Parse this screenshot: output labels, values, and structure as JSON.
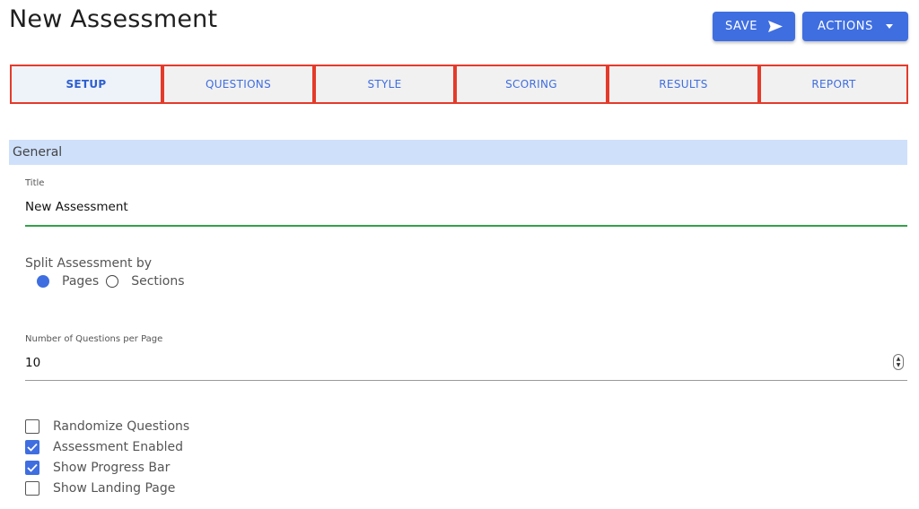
{
  "page_title": "New Assessment",
  "toolbar": {
    "save_label": "SAVE",
    "actions_label": "ACTIONS"
  },
  "tabs": [
    {
      "label": "SETUP",
      "active": true
    },
    {
      "label": "QUESTIONS",
      "active": false
    },
    {
      "label": "STYLE",
      "active": false
    },
    {
      "label": "SCORING",
      "active": false
    },
    {
      "label": "RESULTS",
      "active": false
    },
    {
      "label": "REPORT",
      "active": false
    }
  ],
  "section": {
    "title": "General"
  },
  "title_field": {
    "label": "Title",
    "value": "New Assessment"
  },
  "split": {
    "label": "Split Assessment by",
    "options": [
      {
        "label": "Pages",
        "selected": true
      },
      {
        "label": "Sections",
        "selected": false
      }
    ]
  },
  "questions_per_page": {
    "label": "Number of Questions per Page",
    "value": "10"
  },
  "checkboxes": [
    {
      "label": "Randomize Questions",
      "checked": false
    },
    {
      "label": "Assessment Enabled",
      "checked": true
    },
    {
      "label": "Show Progress Bar",
      "checked": true
    },
    {
      "label": "Show Landing Page",
      "checked": false
    }
  ],
  "colors": {
    "accent": "#3f6ee0",
    "tab_outline": "#e53a2a",
    "section_bg": "#cfe0fb",
    "valid_underline": "#35a04a"
  },
  "icons": {
    "save": "send-icon",
    "actions": "caret-down-icon",
    "stepper": "stepper-arrows-icon",
    "check": "checkmark-icon"
  }
}
